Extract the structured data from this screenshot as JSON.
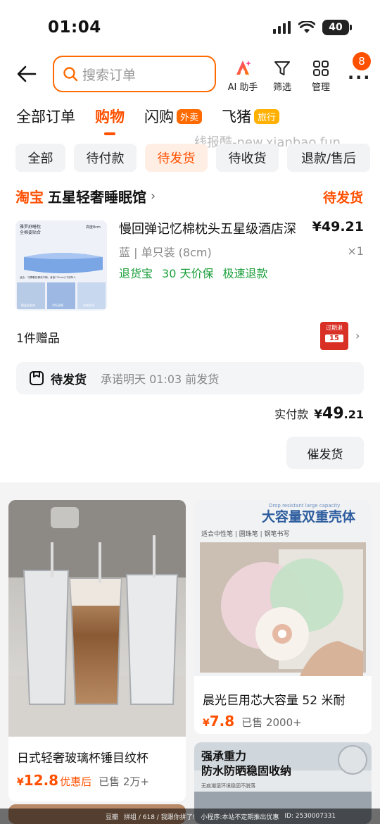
{
  "status": {
    "time": "01:04",
    "battery": "40"
  },
  "search": {
    "placeholder": "搜索订单"
  },
  "header": {
    "ai_label": "AI 助手",
    "filter_label": "筛选",
    "manage_label": "管理",
    "more_badge": "8"
  },
  "tabs": [
    {
      "label": "全部订单"
    },
    {
      "label": "购物",
      "active": true
    },
    {
      "label": "闪购",
      "tag": "外卖"
    },
    {
      "label": "飞猪",
      "tag": "旅行"
    }
  ],
  "watermark": "线报酷-new.xianbao.fun",
  "chips": [
    "全部",
    "待付款",
    "待发货",
    "待收货",
    "退款/售后"
  ],
  "order": {
    "platform": "淘宝",
    "store_name": "五星轻奢睡眠馆",
    "status": "待发货",
    "product": {
      "title": "慢回弹记忆棉枕头五星级酒店深",
      "price": "¥49.21",
      "sku": "蓝 | 单只装 (8cm)",
      "qty": "×1",
      "services": [
        "退货宝",
        "30 天价保",
        "极速退款"
      ],
      "image_text": {
        "line1": "雅罗舒睡枕",
        "line2": "全棉姿贴合",
        "height": "高度8cm",
        "desc": "适合：习惯睡低/喜欢平躺，身高170cm以下成年人",
        "thumbs": [
          "睡姿全贴合",
          "40S全棉",
          "亲肤舒适"
        ]
      }
    },
    "gift": {
      "label": "1件赠品",
      "gift_img_text": "过期退",
      "gift_img_num": "15"
    },
    "ship": {
      "title": "待发货",
      "desc": "承诺明天 01:03 前发货"
    },
    "paid": {
      "label": "实付款",
      "currency": "¥",
      "int": "49",
      "dec": ".21"
    },
    "urge_label": "催发货"
  },
  "recs": [
    {
      "title": "日式轻奢玻璃杯锤目纹杯",
      "currency": "¥",
      "price": "12.8",
      "note": "优惠后",
      "sold": "已售 2万+"
    },
    {
      "title": "晨光巨用芯大容量 52 米耐",
      "currency": "¥",
      "price": "7.8",
      "sold": "已售 2000+",
      "banner_top": "Drop resistant large capacity",
      "banner_title": "大容量双重壳体",
      "banner_sub": "适合中性笔 | 圆珠笔 | 钢笔书写"
    },
    {
      "banner_title_1": "强承重力",
      "banner_title_2": "防水防晒稳固收纳",
      "banner_sub": "无痕潮湿环境稳固不脱落"
    }
  ],
  "bottom_bar": [
    "豆瓣",
    "拼组 / 618 / 我跟你拼了!",
    "小程序:本站不定期推出优惠",
    "ID: 2530007331"
  ],
  "colors": {
    "accent": "#ff5000",
    "green": "#1a9e3a"
  }
}
